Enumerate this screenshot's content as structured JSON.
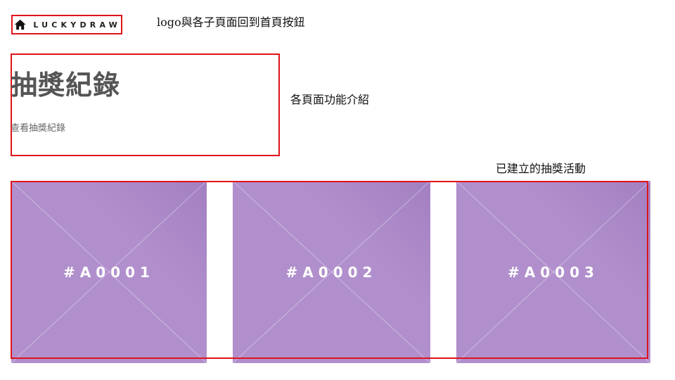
{
  "logo": {
    "text": "LUCKYDRAW",
    "icon": "home-icon"
  },
  "annotations": {
    "logo_note": "logo與各子頁面回到首頁按鈕",
    "intro_note": "各頁面功能介紹",
    "cards_note": "已建立的抽獎活動"
  },
  "intro": {
    "title": "抽獎紀錄",
    "subtitle": "查看抽獎紀錄"
  },
  "cards": [
    {
      "label": "#A0001"
    },
    {
      "label": "#A0002"
    },
    {
      "label": "#A0003"
    }
  ],
  "colors": {
    "card": "#b18fcc",
    "highlight": "#e0141a"
  }
}
